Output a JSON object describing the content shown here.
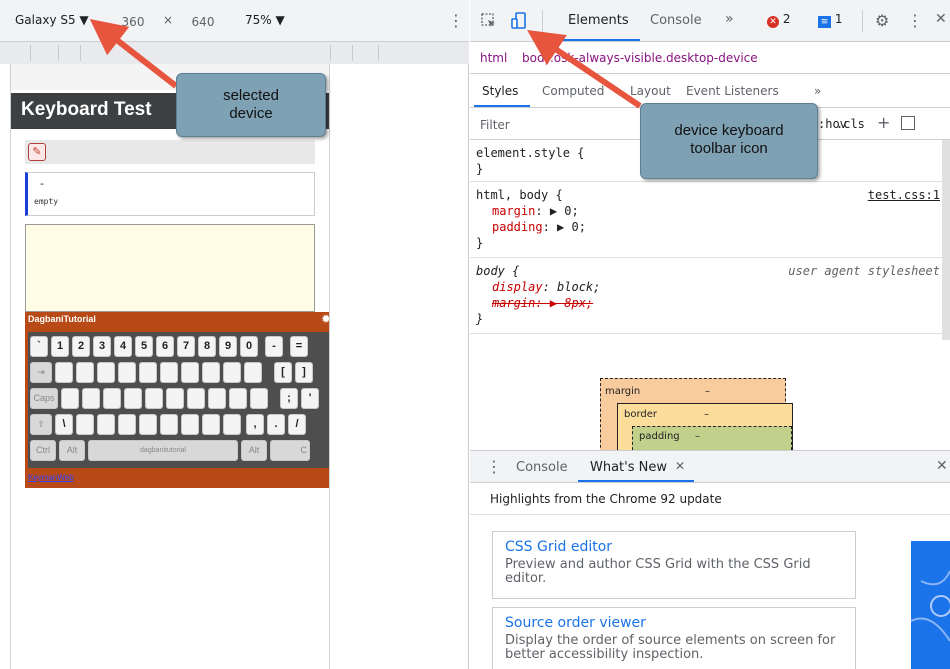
{
  "device_toolbar": {
    "device": "Galaxy S5 ▼",
    "width": "360",
    "times": "×",
    "height": "640",
    "zoom": "75% ▼"
  },
  "viewport": {
    "page_heading": "Keyboard Test",
    "status_dash": "-",
    "status_empty": "empty"
  },
  "keyboard": {
    "title": "DagbaniTutorial",
    "row1": [
      "`",
      "1",
      "2",
      "3",
      "4",
      "5",
      "6",
      "7",
      "8",
      "9",
      "0",
      "-",
      "="
    ],
    "row2_last": [
      "[",
      "]"
    ],
    "row3_last": [
      ";",
      "'"
    ],
    "row4_keys": [
      "\\",
      ",",
      ".",
      "/"
    ],
    "caps_label": "Caps",
    "ctrl_label": "Ctrl",
    "alt_label": "Alt",
    "altgr_label": "Alt",
    "space_label": "dagbanitutorial",
    "right_edge_label": "C",
    "link": "KeymanWeb"
  },
  "devtools": {
    "tabs": {
      "elements": "Elements",
      "console": "Console",
      "more": "»"
    },
    "error_count": "2",
    "message_count": "1",
    "breadcrumb": {
      "html": "html",
      "body": "body.osk-always-visible.desktop-device"
    },
    "subtabs": {
      "styles": "Styles",
      "computed": "Computed",
      "layout": "Layout",
      "event_listeners": "Event Listeners",
      "more": "»"
    },
    "filter_placeholder": "Filter",
    "hov": ":hov",
    "cls": ".cls",
    "rules": {
      "element_style": {
        "selector": "element.style {",
        "close": "}"
      },
      "html_body": {
        "selector": "html, body {",
        "source": "test.css:1",
        "prop1_name": "margin",
        "prop1_value": "▶ 0;",
        "prop2_name": "padding",
        "prop2_value": "▶ 0;",
        "close": "}"
      },
      "body_ua": {
        "selector": "body {",
        "source": "user agent stylesheet",
        "prop1_name": "display",
        "prop1_value": "block;",
        "prop2": "margin: ▶ 8px;",
        "close": "}"
      }
    },
    "box_model": {
      "margin_label": "margin",
      "margin_value": "–",
      "border_label": "border",
      "border_value": "–",
      "padding_label": "padding",
      "padding_value": "–"
    },
    "drawer": {
      "console_tab": "Console",
      "whatsnew_tab": "What's New",
      "highlights": "Highlights from the Chrome 92 update",
      "cards": [
        {
          "title": "CSS Grid editor",
          "desc": "Preview and author CSS Grid with the CSS Grid editor."
        },
        {
          "title": "Source order viewer",
          "desc": "Display the order of source elements on screen for better accessibility inspection."
        }
      ]
    }
  },
  "annotations": {
    "selected_device_line1": "selected",
    "selected_device_line2": "device",
    "keyboard_icon_line1": "device keyboard",
    "keyboard_icon_line2": "toolbar icon",
    "callout_color": "#7fa1b4",
    "arrow_color": "#e8553f"
  }
}
